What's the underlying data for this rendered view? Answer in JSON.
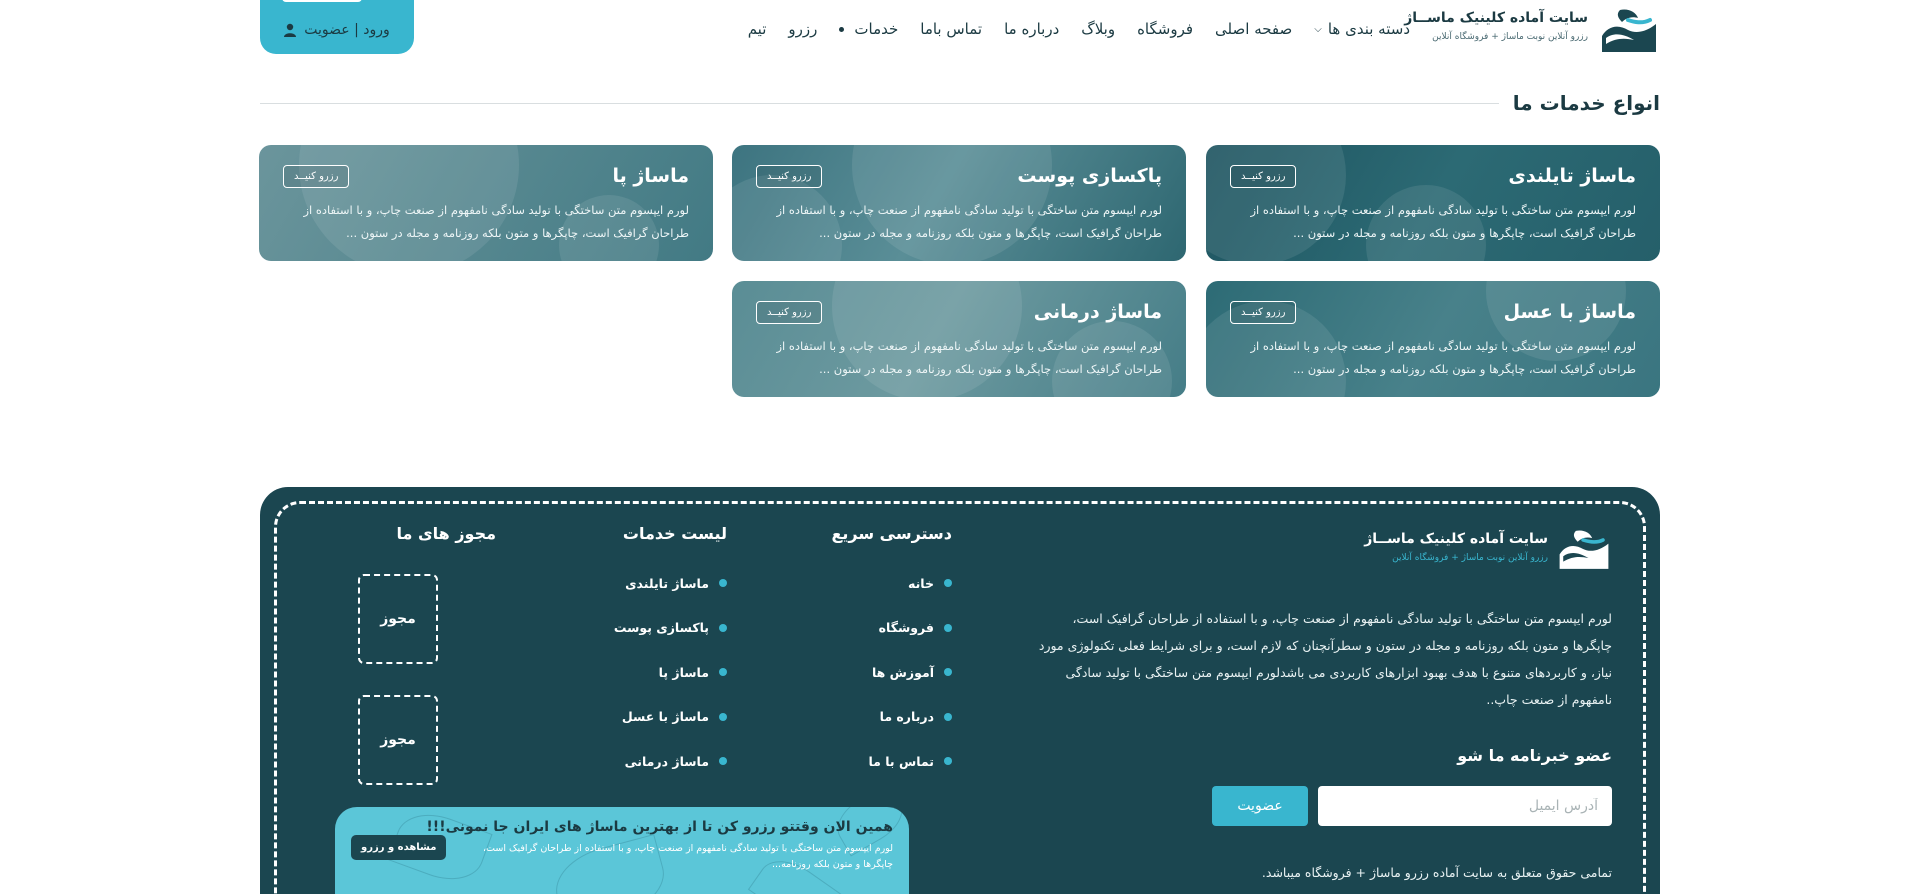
{
  "brand": {
    "title": "سایت آماده کلینیک ماســاژ",
    "subtitle": "رزرو آنلاین نوبت ماساژ + فروشگاه آنلاین"
  },
  "nav": {
    "items": [
      {
        "label": "دسته بندی ها"
      },
      {
        "label": "صفحه اصلی"
      },
      {
        "label": "فروشگاه"
      },
      {
        "label": "وبلاگ"
      },
      {
        "label": "درباره ما"
      },
      {
        "label": "تماس باما"
      },
      {
        "label": "خدمات"
      },
      {
        "label": "رزرو"
      },
      {
        "label": "تیم"
      }
    ],
    "login_label": "ورود | عضویت"
  },
  "services": {
    "section_title": "انواع خدمات ما",
    "book_label": "رزرو کنیــد",
    "description": "لورم ایپسوم متن ساختگی با تولید سادگی نامفهوم از صنعت چاپ، و با استفاده از طراحان گرافیک است، چاپگرها و متون بلکه روزنامه و مجله در ستون ...",
    "items": [
      {
        "title": "ماساژ تایلندی"
      },
      {
        "title": "پاکسازی پوست"
      },
      {
        "title": "ماساژ پا"
      },
      {
        "title": "ماساژ با عسل"
      },
      {
        "title": "ماساژ درمانی"
      }
    ]
  },
  "footer": {
    "brand_title": "سایت آماده کلینیک ماســاژ",
    "brand_subtitle": "رزرو آنلاین نوبت ماساژ + فروشگاه آنلاین",
    "about": "لورم ایپسوم متن ساختگی با تولید سادگی نامفهوم از صنعت چاپ، و با استفاده از طراحان گرافیک است، چاپگرها و متون بلکه روزنامه و مجله در ستون و سطرآنچنان که لازم است، و برای شرایط فعلی تکنولوژی مورد نیاز، و کاربردهای متنوع با هدف بهبود ابزارهای کاربردی می باشدلورم ایپسوم متن ساختگی با تولید سادگی نامفهوم از صنعت چاپ..",
    "newsletter_title": "عضو خبرنامه ما شو",
    "email_placeholder": "آدرس ایمیل",
    "subscribe_label": "عضویت",
    "copyright": "تمامی حقوق متعلق به سایت آماده رزرو ماساژ + فروشگاه میباشد.",
    "quick_title": "دسترسی سریع",
    "quick_links": [
      "خانه",
      "فروشگاه",
      "آموزش ها",
      "درباره ما",
      "تماس با ما"
    ],
    "services_title": "لیست خدمات",
    "service_links": [
      "ماساژ تایلندی",
      "پاکسازی پوست",
      "ماساژ پا",
      "ماساژ با عسل",
      "ماساژ درمانی"
    ],
    "licenses_title": "مجوز های ما",
    "license_label": "مجوز",
    "promo_title": "همین الان وقتتو رزرو کن تا از بهترین ماساژ های ایران جا نمونی!!!",
    "promo_desc": "لورم ایپسوم متن ساختگی با تولید سادگی نامفهوم از صنعت چاپ، و با استفاده از طراحان گرافیک است، چاپگرها و متون بلکه روزنامه...",
    "promo_button": "مشاهده و رزرو"
  },
  "colors": {
    "primary": "#1b4650",
    "accent": "#39b6cf",
    "text": "#1b3a42"
  },
  "icons": [
    "logo-icon",
    "chevron-down-icon",
    "user-icon",
    "bullet-icon"
  ]
}
